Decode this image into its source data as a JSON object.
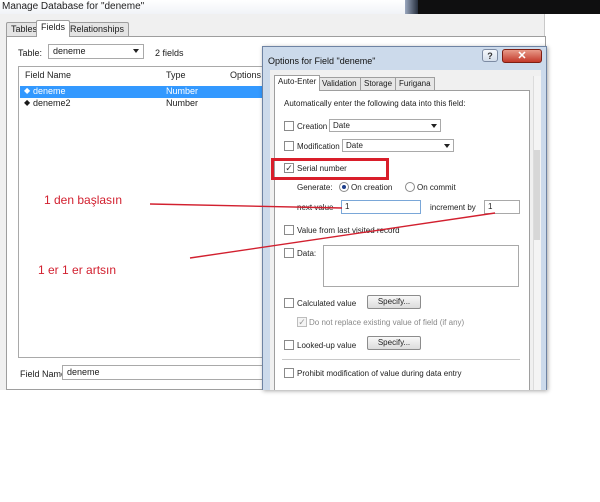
{
  "window": {
    "title": "Manage Database for \"deneme\""
  },
  "tabs": [
    {
      "label": "Tables",
      "active": false
    },
    {
      "label": "Fields",
      "active": true
    },
    {
      "label": "Relationships",
      "active": false
    }
  ],
  "table_selector": {
    "label": "Table:",
    "value": "deneme",
    "field_count": "2 fields"
  },
  "field_list": {
    "headers": [
      "Field Name",
      "Type",
      "Options /"
    ],
    "rows": [
      {
        "name": "deneme",
        "type": "Number",
        "selected": true
      },
      {
        "name": "deneme2",
        "type": "Number",
        "selected": false
      }
    ]
  },
  "field_name": {
    "label": "Field Name:",
    "value": "deneme"
  },
  "dialog": {
    "title": "Options for Field \"deneme\"",
    "help": "?",
    "close": "✕",
    "tabs": [
      {
        "label": "Auto-Enter",
        "active": true
      },
      {
        "label": "Validation",
        "active": false
      },
      {
        "label": "Storage",
        "active": false
      },
      {
        "label": "Furigana",
        "active": false
      }
    ],
    "intro": "Automatically enter the following data into this field:",
    "creation": {
      "label": "Creation",
      "checked": false,
      "value": "Date"
    },
    "modification": {
      "label": "Modification",
      "checked": false,
      "value": "Date"
    },
    "serial": {
      "label": "Serial number",
      "checked": true,
      "generate_label": "Generate:",
      "on_creation": "On creation",
      "on_commit": "On commit",
      "next_value_label": "next value",
      "next_value": "1",
      "increment_label": "increment by",
      "increment": "1"
    },
    "last_visited": {
      "label": "Value from last visited record",
      "checked": false
    },
    "data": {
      "label": "Data:",
      "checked": false
    },
    "calculated": {
      "label": "Calculated value",
      "checked": false,
      "button": "Specify..."
    },
    "do_not_replace": {
      "label": "Do not replace existing value of field (if any)",
      "checked": true
    },
    "looked_up": {
      "label": "Looked-up value",
      "checked": false,
      "button": "Specify..."
    },
    "prohibit": {
      "label": "Prohibit modification of value during data entry",
      "checked": false
    }
  },
  "annotations": {
    "start_note": "1 den başlasın",
    "increment_note": "1 er 1 er artsın",
    "color": "#d2202f"
  },
  "icons": {
    "check": "✓",
    "field_marker": "◆"
  }
}
